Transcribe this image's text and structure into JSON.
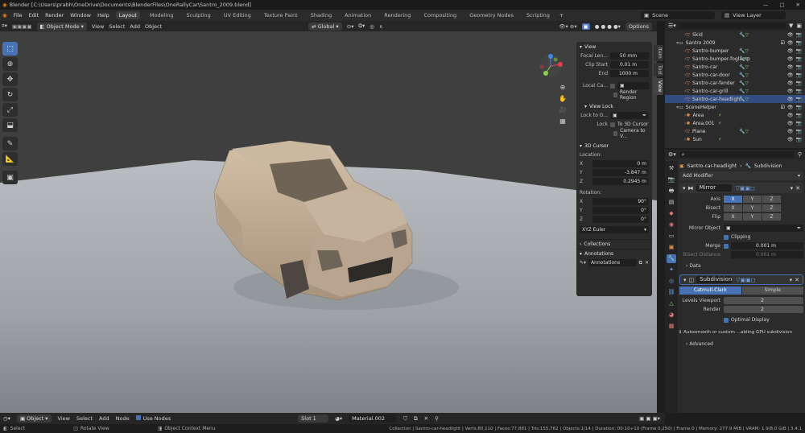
{
  "title": "Blender [C:\\Users\\prabh\\OneDrive\\Documents\\BlenderFiles\\OneRallyCar\\Santro_2009.blend]",
  "menu": [
    "File",
    "Edit",
    "Render",
    "Window",
    "Help"
  ],
  "workspaces": [
    "Layout",
    "Modeling",
    "Sculpting",
    "UV Editing",
    "Texture Paint",
    "Shading",
    "Animation",
    "Rendering",
    "Compositing",
    "Geometry Nodes",
    "Scripting"
  ],
  "active_workspace": "Layout",
  "scene": "Scene",
  "view_layer": "View Layer",
  "viewport_header": {
    "mode": "Object Mode",
    "menus": [
      "View",
      "Select",
      "Add",
      "Object"
    ],
    "orientation": "Global",
    "options": "Options"
  },
  "npanel": {
    "view_title": "View",
    "focal_label": "Focal Len...",
    "focal": "50 mm",
    "clip_start_label": "Clip Start",
    "clip_start": "0.01 m",
    "end_label": "End",
    "end": "1000 m",
    "local_camera": "Local Ca...",
    "render_region": "Render Region",
    "view_lock": "View Lock",
    "lock_to": "Lock to O...",
    "lock": "Lock",
    "to_3d_cursor": "To 3D Cursor",
    "camera_to_view": "Camera to V...",
    "cursor_title": "3D Cursor",
    "location": "Location:",
    "loc_x": "0 m",
    "loc_y": "-3.847 m",
    "loc_z": "0.2945 m",
    "rotation": "Rotation:",
    "rot_x": "90°",
    "rot_y": "0°",
    "rot_z": "0°",
    "rot_mode": "XYZ Euler",
    "collections": "Collections",
    "annotations": "Annotations",
    "annotations_field": "Annotations"
  },
  "sidebar_tabs": [
    "Item",
    "Tool",
    "View"
  ],
  "outliner": [
    {
      "name": "Skid",
      "indent": 2,
      "type": "obj"
    },
    {
      "name": "Santro 2009",
      "indent": 1,
      "type": "coll"
    },
    {
      "name": "Santro-bumper",
      "indent": 2,
      "type": "obj"
    },
    {
      "name": "Santro-bumper-foglamp",
      "indent": 2,
      "type": "obj"
    },
    {
      "name": "Santro-car",
      "indent": 2,
      "type": "obj"
    },
    {
      "name": "Santro-car-door",
      "indent": 2,
      "type": "obj"
    },
    {
      "name": "Santro-car-fender",
      "indent": 2,
      "type": "obj"
    },
    {
      "name": "Santro-car-grill",
      "indent": 2,
      "type": "obj"
    },
    {
      "name": "Santro-car-headlight",
      "indent": 2,
      "type": "obj",
      "selected": true
    },
    {
      "name": "SceneHelper",
      "indent": 1,
      "type": "coll"
    },
    {
      "name": "Area",
      "indent": 2,
      "type": "light"
    },
    {
      "name": "Area.001",
      "indent": 2,
      "type": "light"
    },
    {
      "name": "Plane",
      "indent": 2,
      "type": "obj"
    },
    {
      "name": "Sun",
      "indent": 2,
      "type": "light"
    }
  ],
  "props": {
    "breadcrumb_obj": "Santro-car-headlight",
    "breadcrumb_mod": "Subdivision",
    "add_modifier": "Add Modifier",
    "mirror": {
      "name": "Mirror",
      "axis": "Axis",
      "bisect": "Bisect",
      "flip": "Flip",
      "x": "X",
      "y": "Y",
      "z": "Z",
      "mirror_object": "Mirror Object",
      "clipping": "Clipping",
      "merge": "Merge",
      "merge_val": "0.001 m",
      "bisect_distance": "Bisect Distance",
      "bisect_val": "0.001 m",
      "data": "Data"
    },
    "subsurf": {
      "name": "Subdivision",
      "catmull": "Catmull-Clark",
      "simple": "Simple",
      "levels_viewport": "Levels Viewport",
      "levels_viewport_val": "2",
      "render": "Render",
      "render_val": "2",
      "optimal": "Optimal Display",
      "warning": "Autosmooth or custom ...abling GPU subdivision",
      "advanced": "Advanced"
    }
  },
  "bottom_header": {
    "mode": "Object",
    "menus": [
      "View",
      "Select",
      "Add",
      "Node"
    ],
    "use_nodes": "Use Nodes",
    "slot": "Slot 1",
    "material": "Material.002"
  },
  "status": {
    "select": "Select",
    "rotate": "Rotate View",
    "context": "Object Context Menu",
    "stats": "Collection | Santro-car-headlight | Verts:80,110 | Faces:77,881 | Tris:155,762 | Objects:1/14 | Duration: 00:10+10 (Frame 0,250) | Frame:0 | Memory: 277.9 MiB | VRAM: 1.9/8.0 GiB | 3.4.1"
  },
  "colors": {
    "accent": "#4772b3",
    "selected_row": "#334d80",
    "object_orange": "#e0944a",
    "light_green": "#7fcf67"
  }
}
